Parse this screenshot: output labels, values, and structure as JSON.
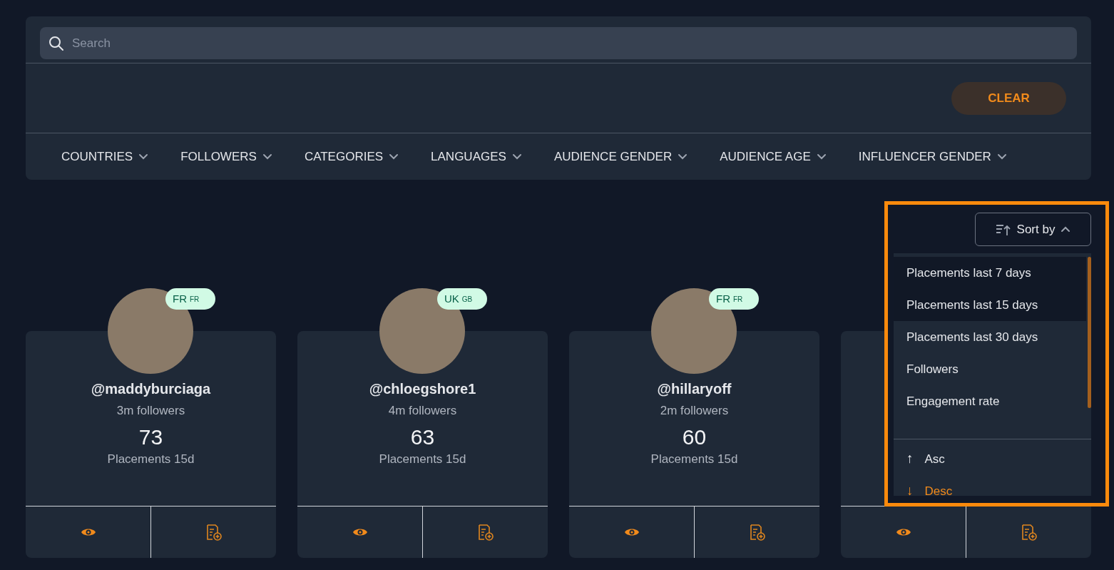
{
  "search": {
    "placeholder": "Search"
  },
  "clear_button": "CLEAR",
  "filters": [
    {
      "label": "COUNTRIES"
    },
    {
      "label": "FOLLOWERS"
    },
    {
      "label": "CATEGORIES"
    },
    {
      "label": "LANGUAGES"
    },
    {
      "label": "AUDIENCE GENDER"
    },
    {
      "label": "AUDIENCE AGE"
    },
    {
      "label": "INFLUENCER GENDER"
    }
  ],
  "sort": {
    "label": "Sort by",
    "expanded": true,
    "options": [
      {
        "label": "Placements last 7 days",
        "hovered": true
      },
      {
        "label": "Placements last 15 days",
        "hovered": true
      },
      {
        "label": "Placements last 30 days",
        "hovered": false
      },
      {
        "label": "Followers",
        "hovered": false
      },
      {
        "label": "Engagement rate",
        "hovered": false
      }
    ],
    "order": [
      {
        "arrow": "↑",
        "label": "Asc",
        "selected": false
      },
      {
        "arrow": "↓",
        "label": "Desc",
        "selected": true
      }
    ]
  },
  "cards": [
    {
      "handle": "@maddyburciaga",
      "country": "FR",
      "country_code": "FR",
      "followers": "3m followers",
      "count": "73",
      "count_label": "Placements 15d"
    },
    {
      "handle": "@chloegshore1",
      "country": "UK",
      "country_code": "GB",
      "followers": "4m followers",
      "count": "63",
      "count_label": "Placements 15d"
    },
    {
      "handle": "@hillaryoff",
      "country": "FR",
      "country_code": "FR",
      "followers": "2m followers",
      "count": "60",
      "count_label": "Placements 15d"
    },
    {
      "covered": true
    }
  ]
}
